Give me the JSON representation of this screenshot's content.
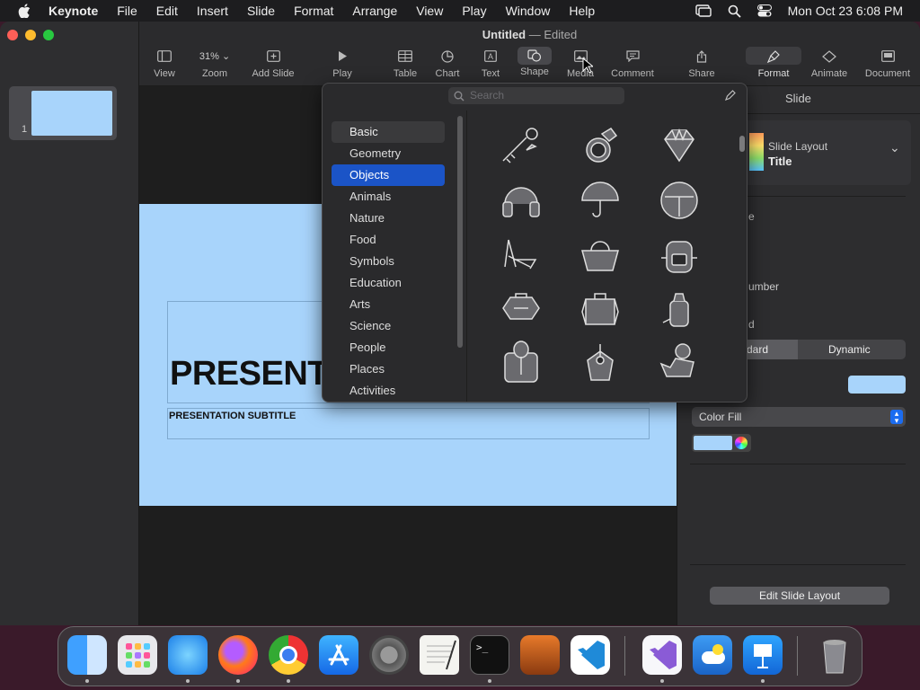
{
  "menubar": {
    "app": "Keynote",
    "items": [
      "File",
      "Edit",
      "Insert",
      "Slide",
      "Format",
      "Arrange",
      "View",
      "Play",
      "Window",
      "Help"
    ],
    "clock": "Mon Oct 23  6:08 PM"
  },
  "document": {
    "title": "Untitled",
    "separator": "—",
    "status": "Edited"
  },
  "toolbar": {
    "view": "View",
    "zoom_value": "31%",
    "zoom": "Zoom",
    "add_slide": "Add Slide",
    "play": "Play",
    "table": "Table",
    "chart": "Chart",
    "text": "Text",
    "shape": "Shape",
    "media": "Media",
    "comment": "Comment",
    "share": "Share",
    "format": "Format",
    "animate": "Animate",
    "document": "Document"
  },
  "navigator": {
    "slide_number": "1"
  },
  "slide": {
    "title": "PRESENTATION",
    "subtitle": "PRESENTATION SUBTITLE"
  },
  "shape_library": {
    "search_placeholder": "Search",
    "categories": [
      "Basic",
      "Geometry",
      "Objects",
      "Animals",
      "Nature",
      "Food",
      "Symbols",
      "Education",
      "Arts",
      "Science",
      "People",
      "Places",
      "Activities"
    ],
    "selected_category": "Objects",
    "shapes": [
      "key-shape",
      "ring-shape",
      "diamond-shape",
      "headphones-shape",
      "umbrella-shape",
      "umbrella-open-shape",
      "beach-chair-shape",
      "shopping-bag-shape",
      "backpack-shape",
      "luggage-shape",
      "suitcase-shape",
      "baby-bottle-shape",
      "maracas-shape",
      "tag-shape",
      "rubber-duck-shape"
    ]
  },
  "inspector": {
    "section_title": "Slide",
    "layout_label": "Slide Layout",
    "layout_value": "Title",
    "row_fragment_1": "e",
    "row_fragment_2": "umber",
    "row_fragment_3": "d",
    "segment_left": "dard",
    "segment_right": "Dynamic",
    "fill_type": "Color Fill",
    "edit_button": "Edit Slide Layout",
    "fill_color": "#a8d4fb"
  },
  "dock": {
    "apps": [
      "finder-icon",
      "launchpad-icon",
      "safari-icon",
      "firefox-icon",
      "chrome-icon",
      "app-store-icon",
      "system-settings-icon",
      "textedit-icon",
      "terminal-icon",
      "garageband-icon",
      "vscode-icon",
      "visual-studio-icon",
      "weather-icon",
      "keynote-icon",
      "trash-icon"
    ]
  }
}
